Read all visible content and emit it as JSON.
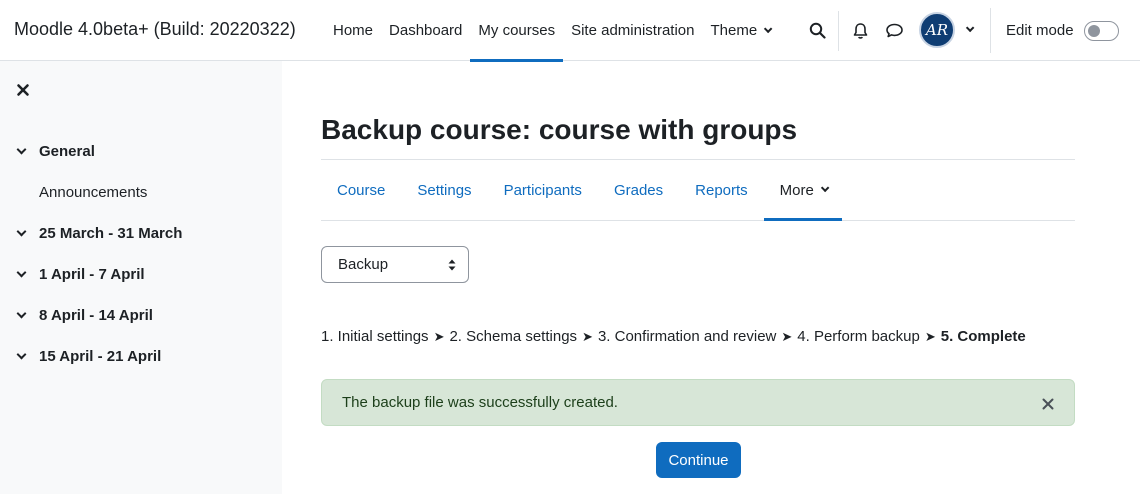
{
  "site": {
    "name": "Moodle 4.0beta+ (Build: 20220322)"
  },
  "primary_nav": [
    {
      "label": "Home"
    },
    {
      "label": "Dashboard"
    },
    {
      "label": "My courses"
    },
    {
      "label": "Site administration"
    },
    {
      "label": "Theme"
    }
  ],
  "user": {
    "initials": "AR"
  },
  "edit_mode": {
    "label": "Edit mode",
    "enabled": false
  },
  "course_index": {
    "sections": [
      {
        "title": "General",
        "items": [
          "Announcements"
        ]
      },
      {
        "title": "25 March - 31 March"
      },
      {
        "title": "1 April - 7 April"
      },
      {
        "title": "8 April - 14 April"
      },
      {
        "title": "15 April - 21 April"
      }
    ]
  },
  "page": {
    "title": "Backup course: course with groups"
  },
  "secondary_nav": [
    {
      "label": "Course"
    },
    {
      "label": "Settings"
    },
    {
      "label": "Participants"
    },
    {
      "label": "Grades"
    },
    {
      "label": "Reports"
    },
    {
      "label": "More"
    }
  ],
  "action_select": {
    "value": "Backup"
  },
  "progress": {
    "steps": [
      "1. Initial settings",
      "2. Schema settings",
      "3. Confirmation and review",
      "4. Perform backup",
      "5. Complete"
    ],
    "separator": "➤"
  },
  "alert": {
    "message": "The backup file was successfully created."
  },
  "continue_button": {
    "label": "Continue"
  },
  "colors": {
    "primary": "#0f6cbf",
    "success_bg": "#d7e6d7",
    "drawer_bg": "#f8f9fa"
  }
}
